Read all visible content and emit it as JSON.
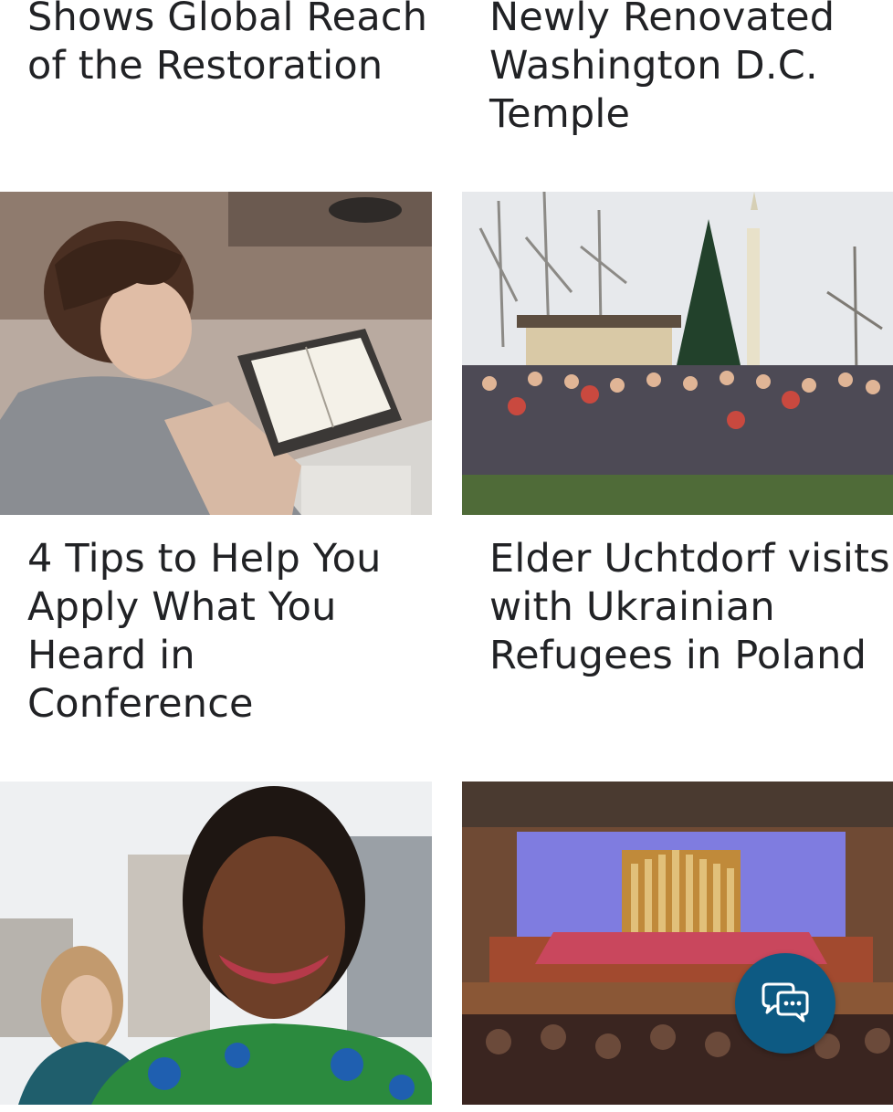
{
  "articles": [
    {
      "title": "Shows Global Reach of the Restoration",
      "image": "temple-open-house-photo"
    },
    {
      "title": "Newly Renovated Washington D.C. Temple",
      "image": "washington-temple-photo"
    },
    {
      "title": "4 Tips to Help You Apply What You Heard in Conference",
      "image": "man-reading-scriptures-photo"
    },
    {
      "title": "Elder Uchtdorf visits with Ukrainian Refugees in Poland",
      "image": "ukrainian-refugees-group-photo"
    },
    {
      "title": "",
      "image": "smiling-woman-photo"
    },
    {
      "title": "",
      "image": "conference-center-choir-photo"
    }
  ],
  "chat": {
    "icon": "chat-bubbles-icon"
  },
  "colors": {
    "text": "#212225",
    "chat_button": "#0d5a83",
    "background": "#ffffff"
  }
}
